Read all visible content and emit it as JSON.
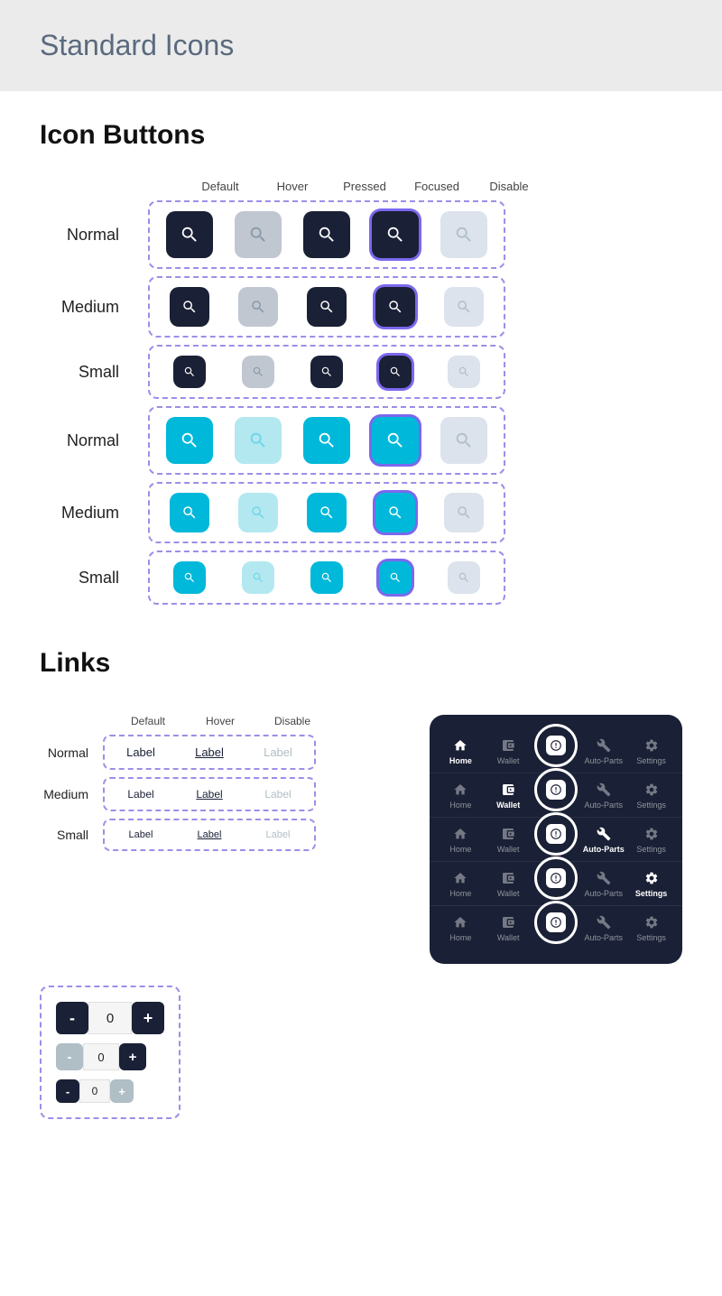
{
  "header": {
    "title": "Standard Icons"
  },
  "iconButtons": {
    "sectionTitle": "Icon Buttons",
    "columnHeaders": [
      "Default",
      "Hover",
      "Pressed",
      "Focused",
      "Disable"
    ],
    "rows": [
      {
        "label": "Normal",
        "theme": "dark",
        "size": "normal"
      },
      {
        "label": "Medium",
        "theme": "dark",
        "size": "medium"
      },
      {
        "label": "Small",
        "theme": "dark",
        "size": "small"
      },
      {
        "label": "Normal",
        "theme": "cyan",
        "size": "normal"
      },
      {
        "label": "Medium",
        "theme": "cyan",
        "size": "medium"
      },
      {
        "label": "Small",
        "theme": "cyan",
        "size": "small"
      }
    ]
  },
  "links": {
    "sectionTitle": "Links",
    "columnHeaders": [
      "Default",
      "Hover",
      "Disable"
    ],
    "rows": [
      {
        "label": "Normal",
        "size": "normal"
      },
      {
        "label": "Medium",
        "size": "medium"
      },
      {
        "label": "Small",
        "size": "small"
      }
    ],
    "linkLabel": "Label"
  },
  "stepper": {
    "rows": [
      {
        "minus": "-",
        "value": "0",
        "plus": "+",
        "size": "normal"
      },
      {
        "minus": "-",
        "value": "0",
        "plus": "+",
        "size": "medium",
        "disabled": true
      },
      {
        "minus": "-",
        "value": "0",
        "plus": "+",
        "size": "small",
        "plusDisabled": true
      }
    ]
  },
  "navPreview": {
    "rows": [
      {
        "activeIndex": 0,
        "items": [
          "Home",
          "Wallet",
          "",
          "Auto-Parts",
          "Settings"
        ]
      },
      {
        "activeIndex": 1,
        "items": [
          "Home",
          "Wallet",
          "",
          "Auto-Parts",
          "Settings"
        ]
      },
      {
        "activeIndex": 3,
        "items": [
          "Home",
          "Wallet",
          "",
          "Auto-Parts",
          "Settings"
        ]
      },
      {
        "activeIndex": 4,
        "items": [
          "Home",
          "Wallet",
          "",
          "Auto-Parts",
          "Settings"
        ]
      },
      {
        "activeIndex": -1,
        "items": [
          "Home",
          "Wallet",
          "",
          "Auto-Parts",
          "Settings"
        ]
      }
    ]
  }
}
